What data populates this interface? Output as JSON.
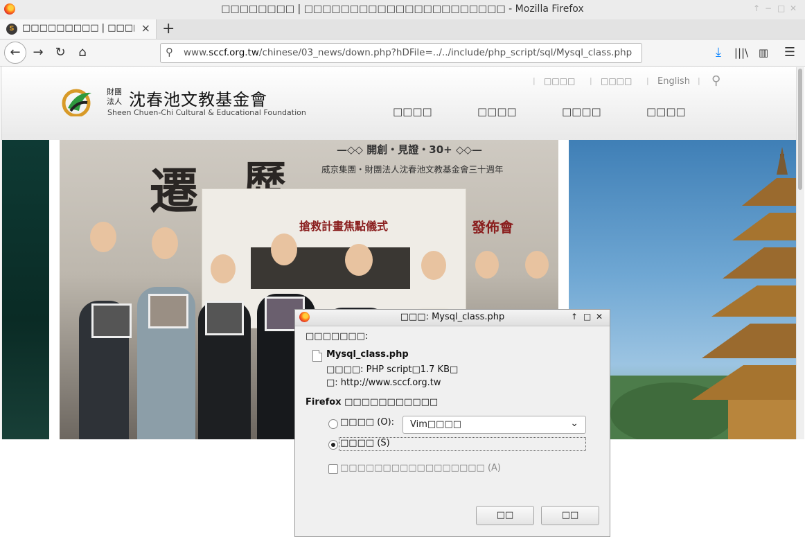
{
  "window": {
    "title": "□□□□□□□□ | □□□□□□□□□□□□□□□□□□□□□□ - Mozilla Firefox"
  },
  "tab": {
    "label": "□□□□□□□□□ | □□□□",
    "close": "×",
    "new_tab": "+"
  },
  "nav": {
    "url_prefix": "www.",
    "url_domain": "sccf.org.tw",
    "url_path": "/chinese/03_news/down.php?hDFile=../../include/php_script/sql/Mysql_class.php"
  },
  "site": {
    "logo_small_1": "財團",
    "logo_small_2": "法人",
    "logo_name": "沈春池文教基金會",
    "logo_en": "Sheen Chuen-Chi Cultural & Educational Foundation",
    "top_links": [
      "□□□□",
      "□□□□",
      "English"
    ],
    "main_nav": [
      "□□□□",
      "□□□□",
      "□□□□",
      "□□□□"
    ]
  },
  "banner": {
    "callig_1": "遷",
    "callig_2": "歷",
    "headline": "—◇◇ 開創・見證・30+ ◇◇—",
    "subline": "威京集團・財團法人沈春池文教基金會三十週年",
    "frame_title": "搶救計畫焦點儀式",
    "frame_right": "發佈會"
  },
  "dialog": {
    "title": "□□□: Mysql_class.php",
    "intro": "□□□□□□□:",
    "filename": "Mysql_class.php",
    "type_line": "□□□□: PHP script□1.7 KB□",
    "from_line": "□: http://www.sccf.org.tw",
    "question": "Firefox □□□□□□□□□□□",
    "open_with": "□□□□ (O):",
    "open_app": "Vim□□□□",
    "save_file": "□□□□ (S)",
    "remember": "□□□□□□□□□□□□□□□□□ (A)",
    "ok": "□□",
    "cancel": "□□"
  }
}
